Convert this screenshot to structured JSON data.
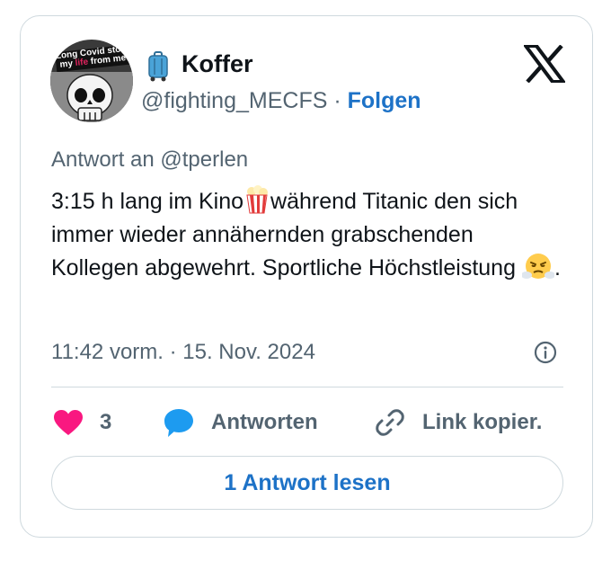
{
  "author": {
    "avatar_text_line1": "Long Covid stole",
    "avatar_text_line2_a": "my ",
    "avatar_text_line2_b": "life",
    "avatar_text_line2_c": " from me",
    "name_icon": "luggage-icon",
    "name": "Koffer",
    "handle": "@fighting_MECFS",
    "separator": "·",
    "follow_label": "Folgen"
  },
  "platform_logo": "x-logo-icon",
  "reply_to": "Antwort an @tperlen",
  "tweet": {
    "text_part1": "3:15 h lang im Kino",
    "emoji1": "popcorn-emoji",
    "text_part2": "während Titanic den sich immer wieder annähernden grabschenden Kollegen abgewehrt. Sportliche Höchstleistung ",
    "emoji2": "face-with-steam-emoji",
    "text_part3": "."
  },
  "timestamp": "11:42 vorm. · 15. Nov. 2024",
  "actions": {
    "like_count": "3",
    "reply_label": "Antworten",
    "copy_link_label": "Link kopier."
  },
  "read_replies_label": "1 Antwort lesen",
  "colors": {
    "accent": "#1d72c7",
    "like": "#f91880",
    "reply_icon": "#1d9bf0",
    "muted": "#536471",
    "border": "#cfd9de"
  }
}
